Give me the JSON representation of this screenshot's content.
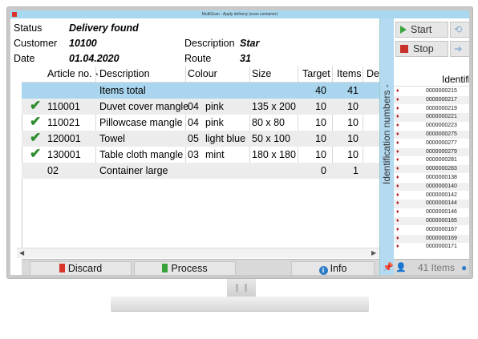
{
  "window": {
    "title": "MultiScan - Apply delivery (scan container)"
  },
  "header": {
    "status_label": "Status",
    "status_value": "Delivery found",
    "customer_label": "Customer",
    "customer_value": "10100",
    "description_label": "Description",
    "description_value": "Star",
    "date_label": "Date",
    "date_value": "01.04.2020",
    "route_label": "Route",
    "route_value": "31"
  },
  "table": {
    "columns": [
      "Article no.",
      "Description",
      "Colour",
      "Size",
      "Target",
      "Items",
      "De"
    ],
    "rows": [
      {
        "check": "",
        "article": "",
        "description": "Items total",
        "colour_code": "",
        "colour": "",
        "size": "",
        "target": "40",
        "items": "41"
      },
      {
        "check": "✔",
        "article": "110001",
        "description": "Duvet cover mangle",
        "colour_code": "04",
        "colour": "pink",
        "size": "135 x 200",
        "target": "10",
        "items": "10"
      },
      {
        "check": "✔",
        "article": "110021",
        "description": "Pillowcase mangle",
        "colour_code": "04",
        "colour": "pink",
        "size": "80 x 80",
        "target": "10",
        "items": "10"
      },
      {
        "check": "✔",
        "article": "120001",
        "description": "Towel",
        "colour_code": "05",
        "colour": "light blue",
        "size": "50 x 100",
        "target": "10",
        "items": "10"
      },
      {
        "check": "✔",
        "article": "130001",
        "description": "Table cloth mangle",
        "colour_code": "03",
        "colour": "mint",
        "size": "180 x 180",
        "target": "10",
        "items": "10"
      },
      {
        "check": "",
        "article": "02",
        "description": "Container large",
        "colour_code": "",
        "colour": "",
        "size": "",
        "target": "0",
        "items": "1"
      }
    ]
  },
  "bottom": {
    "discard": "Discard",
    "process": "Process",
    "info": "Info"
  },
  "side_panel": {
    "title": "Identification numbers -"
  },
  "right": {
    "start": "Start",
    "stop": "Stop",
    "ident_header": "Identificat",
    "items_count": "41 Items",
    "idents": [
      "0000000215",
      "0000000217",
      "0000000219",
      "0000000221",
      "0000000223",
      "0000000275",
      "0000000277",
      "0000000279",
      "0000000281",
      "0000000283",
      "0000000138",
      "0000000140",
      "0000000142",
      "0000000144",
      "0000000146",
      "0000000165",
      "0000000167",
      "0000000169",
      "0000000171"
    ]
  },
  "colors": {
    "selection": "#a9d5ee",
    "titlebar": "#a8d8f0",
    "check": "#2f8d2f",
    "stop": "#c8302a",
    "start": "#3aa23a"
  }
}
